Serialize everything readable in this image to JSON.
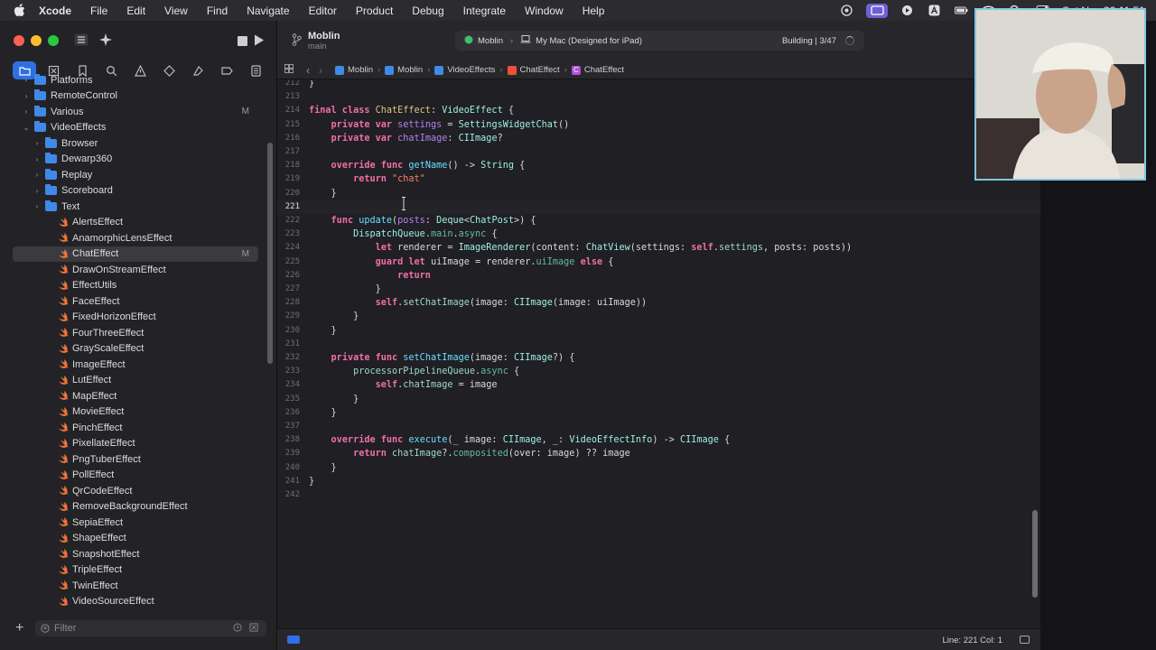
{
  "menubar": {
    "app": "Xcode",
    "items": [
      "File",
      "Edit",
      "View",
      "Find",
      "Navigate",
      "Editor",
      "Product",
      "Debug",
      "Integrate",
      "Window",
      "Help"
    ],
    "datetime": "Sat Nov 30 11:51"
  },
  "toolbar": {
    "project": "Moblin",
    "branch": "main",
    "scheme": "Moblin",
    "destination": "My Mac (Designed for iPad)",
    "status": "Building | 3/47"
  },
  "jumpbar": [
    "Moblin",
    "Moblin",
    "VideoEffects",
    "ChatEffect",
    "ChatEffect"
  ],
  "sidebar": {
    "filter_placeholder": "Filter",
    "items": [
      {
        "label": "Platforms",
        "level": 1,
        "kind": "folder",
        "chev": "›"
      },
      {
        "label": "RemoteControl",
        "level": 1,
        "kind": "folder",
        "chev": "›"
      },
      {
        "label": "Various",
        "level": 1,
        "kind": "folder",
        "chev": "›",
        "badge": "M"
      },
      {
        "label": "VideoEffects",
        "level": 1,
        "kind": "folder",
        "chev": "⌄"
      },
      {
        "label": "Browser",
        "level": 2,
        "kind": "folder",
        "chev": "›"
      },
      {
        "label": "Dewarp360",
        "level": 2,
        "kind": "folder",
        "chev": "›"
      },
      {
        "label": "Replay",
        "level": 2,
        "kind": "folder",
        "chev": "›"
      },
      {
        "label": "Scoreboard",
        "level": 2,
        "kind": "folder",
        "chev": "›"
      },
      {
        "label": "Text",
        "level": 2,
        "kind": "folder",
        "chev": "›"
      },
      {
        "label": "AlertsEffect",
        "level": 2,
        "kind": "swift"
      },
      {
        "label": "AnamorphicLensEffect",
        "level": 2,
        "kind": "swift"
      },
      {
        "label": "ChatEffect",
        "level": 2,
        "kind": "swift",
        "badge": "M",
        "selected": true
      },
      {
        "label": "DrawOnStreamEffect",
        "level": 2,
        "kind": "swift"
      },
      {
        "label": "EffectUtils",
        "level": 2,
        "kind": "swift"
      },
      {
        "label": "FaceEffect",
        "level": 2,
        "kind": "swift"
      },
      {
        "label": "FixedHorizonEffect",
        "level": 2,
        "kind": "swift"
      },
      {
        "label": "FourThreeEffect",
        "level": 2,
        "kind": "swift"
      },
      {
        "label": "GrayScaleEffect",
        "level": 2,
        "kind": "swift"
      },
      {
        "label": "ImageEffect",
        "level": 2,
        "kind": "swift"
      },
      {
        "label": "LutEffect",
        "level": 2,
        "kind": "swift"
      },
      {
        "label": "MapEffect",
        "level": 2,
        "kind": "swift"
      },
      {
        "label": "MovieEffect",
        "level": 2,
        "kind": "swift"
      },
      {
        "label": "PinchEffect",
        "level": 2,
        "kind": "swift"
      },
      {
        "label": "PixellateEffect",
        "level": 2,
        "kind": "swift"
      },
      {
        "label": "PngTuberEffect",
        "level": 2,
        "kind": "swift"
      },
      {
        "label": "PollEffect",
        "level": 2,
        "kind": "swift"
      },
      {
        "label": "QrCodeEffect",
        "level": 2,
        "kind": "swift"
      },
      {
        "label": "RemoveBackgroundEffect",
        "level": 2,
        "kind": "swift"
      },
      {
        "label": "SepiaEffect",
        "level": 2,
        "kind": "swift"
      },
      {
        "label": "ShapeEffect",
        "level": 2,
        "kind": "swift"
      },
      {
        "label": "SnapshotEffect",
        "level": 2,
        "kind": "swift"
      },
      {
        "label": "TripleEffect",
        "level": 2,
        "kind": "swift"
      },
      {
        "label": "TwinEffect",
        "level": 2,
        "kind": "swift"
      },
      {
        "label": "VideoSourceEffect",
        "level": 2,
        "kind": "swift"
      }
    ]
  },
  "editor": {
    "current_line": 221,
    "lines": [
      {
        "n": 212,
        "t": [
          [
            "p",
            "}"
          ]
        ]
      },
      {
        "n": 213,
        "t": []
      },
      {
        "n": 214,
        "t": [
          [
            "kw",
            "final class "
          ],
          [
            "ty",
            "ChatEffect"
          ],
          [
            "p",
            ": "
          ],
          [
            "ty2",
            "VideoEffect"
          ],
          [
            "p",
            " {"
          ]
        ]
      },
      {
        "n": 215,
        "t": [
          [
            "p",
            "    "
          ],
          [
            "kw",
            "private var "
          ],
          [
            "pr",
            "settings"
          ],
          [
            "p",
            " = "
          ],
          [
            "ty2",
            "SettingsWidgetChat"
          ],
          [
            "p",
            "()"
          ]
        ]
      },
      {
        "n": 216,
        "t": [
          [
            "p",
            "    "
          ],
          [
            "kw",
            "private var "
          ],
          [
            "pr",
            "chatImage"
          ],
          [
            "p",
            ": "
          ],
          [
            "ty2",
            "CIImage"
          ],
          [
            "p",
            "?"
          ]
        ]
      },
      {
        "n": 217,
        "t": []
      },
      {
        "n": 218,
        "t": [
          [
            "p",
            "    "
          ],
          [
            "kw",
            "override func "
          ],
          [
            "fn",
            "getName"
          ],
          [
            "p",
            "() -> "
          ],
          [
            "ty2",
            "String"
          ],
          [
            "p",
            " {"
          ]
        ]
      },
      {
        "n": 219,
        "t": [
          [
            "p",
            "        "
          ],
          [
            "kw",
            "return "
          ],
          [
            "st",
            "\"chat\""
          ]
        ]
      },
      {
        "n": 220,
        "t": [
          [
            "p",
            "    }"
          ]
        ]
      },
      {
        "n": 221,
        "t": []
      },
      {
        "n": 222,
        "t": [
          [
            "p",
            "    "
          ],
          [
            "kw",
            "func "
          ],
          [
            "fn",
            "update"
          ],
          [
            "p",
            "("
          ],
          [
            "pr",
            "posts"
          ],
          [
            "p",
            ": "
          ],
          [
            "ty2",
            "Deque"
          ],
          [
            "p",
            "<"
          ],
          [
            "ty2",
            "ChatPost"
          ],
          [
            "p",
            ">) {"
          ]
        ]
      },
      {
        "n": 223,
        "t": [
          [
            "p",
            "        "
          ],
          [
            "ty2",
            "DispatchQueue"
          ],
          [
            "p",
            "."
          ],
          [
            "fx",
            "main"
          ],
          [
            "p",
            "."
          ],
          [
            "fx",
            "async"
          ],
          [
            "p",
            " {"
          ]
        ]
      },
      {
        "n": 224,
        "t": [
          [
            "p",
            "            "
          ],
          [
            "kw",
            "let "
          ],
          [
            "p",
            "renderer = "
          ],
          [
            "ty2",
            "ImageRenderer"
          ],
          [
            "p",
            "("
          ],
          [
            "p",
            "content: "
          ],
          [
            "ty2",
            "ChatView"
          ],
          [
            "p",
            "(settings: "
          ],
          [
            "kw",
            "self"
          ],
          [
            "p",
            "."
          ],
          [
            "vr",
            "settings"
          ],
          [
            "p",
            ", posts: posts))"
          ]
        ]
      },
      {
        "n": 225,
        "t": [
          [
            "p",
            "            "
          ],
          [
            "kw",
            "guard let "
          ],
          [
            "p",
            "uiImage = renderer."
          ],
          [
            "fx",
            "uiImage"
          ],
          [
            "p",
            " "
          ],
          [
            "kw",
            "else"
          ],
          [
            "p",
            " {"
          ]
        ]
      },
      {
        "n": 226,
        "t": [
          [
            "p",
            "                "
          ],
          [
            "kw",
            "return"
          ]
        ]
      },
      {
        "n": 227,
        "t": [
          [
            "p",
            "            }"
          ]
        ]
      },
      {
        "n": 228,
        "t": [
          [
            "p",
            "            "
          ],
          [
            "kw",
            "self"
          ],
          [
            "p",
            "."
          ],
          [
            "vr",
            "setChatImage"
          ],
          [
            "p",
            "(image: "
          ],
          [
            "ty2",
            "CIImage"
          ],
          [
            "p",
            "(image: uiImage))"
          ]
        ]
      },
      {
        "n": 229,
        "t": [
          [
            "p",
            "        }"
          ]
        ]
      },
      {
        "n": 230,
        "t": [
          [
            "p",
            "    }"
          ]
        ]
      },
      {
        "n": 231,
        "t": []
      },
      {
        "n": 232,
        "t": [
          [
            "p",
            "    "
          ],
          [
            "kw",
            "private func "
          ],
          [
            "fn",
            "setChatImage"
          ],
          [
            "p",
            "(image: "
          ],
          [
            "ty2",
            "CIImage"
          ],
          [
            "p",
            "?) {"
          ]
        ]
      },
      {
        "n": 233,
        "t": [
          [
            "p",
            "        "
          ],
          [
            "vr",
            "processorPipelineQueue"
          ],
          [
            "p",
            "."
          ],
          [
            "fx",
            "async"
          ],
          [
            "p",
            " {"
          ]
        ]
      },
      {
        "n": 234,
        "t": [
          [
            "p",
            "            "
          ],
          [
            "kw",
            "self"
          ],
          [
            "p",
            "."
          ],
          [
            "vr",
            "chatImage"
          ],
          [
            "p",
            " = image"
          ]
        ]
      },
      {
        "n": 235,
        "t": [
          [
            "p",
            "        }"
          ]
        ]
      },
      {
        "n": 236,
        "t": [
          [
            "p",
            "    }"
          ]
        ]
      },
      {
        "n": 237,
        "t": []
      },
      {
        "n": 238,
        "t": [
          [
            "p",
            "    "
          ],
          [
            "kw",
            "override func "
          ],
          [
            "fn",
            "execute"
          ],
          [
            "p",
            "(_ image: "
          ],
          [
            "ty2",
            "CIImage"
          ],
          [
            "p",
            ", _: "
          ],
          [
            "ty2",
            "VideoEffectInfo"
          ],
          [
            "p",
            ") -> "
          ],
          [
            "ty2",
            "CIImage"
          ],
          [
            "p",
            " {"
          ]
        ]
      },
      {
        "n": 239,
        "t": [
          [
            "p",
            "        "
          ],
          [
            "kw",
            "return "
          ],
          [
            "vr",
            "chatImage"
          ],
          [
            "p",
            "?."
          ],
          [
            "fx",
            "composited"
          ],
          [
            "p",
            "(over: image) ?? image"
          ]
        ]
      },
      {
        "n": 240,
        "t": [
          [
            "p",
            "    }"
          ]
        ]
      },
      {
        "n": 241,
        "t": [
          [
            "p",
            "}"
          ]
        ]
      },
      {
        "n": 242,
        "t": []
      }
    ]
  },
  "statusbar": {
    "position": "Line: 221  Col: 1"
  }
}
